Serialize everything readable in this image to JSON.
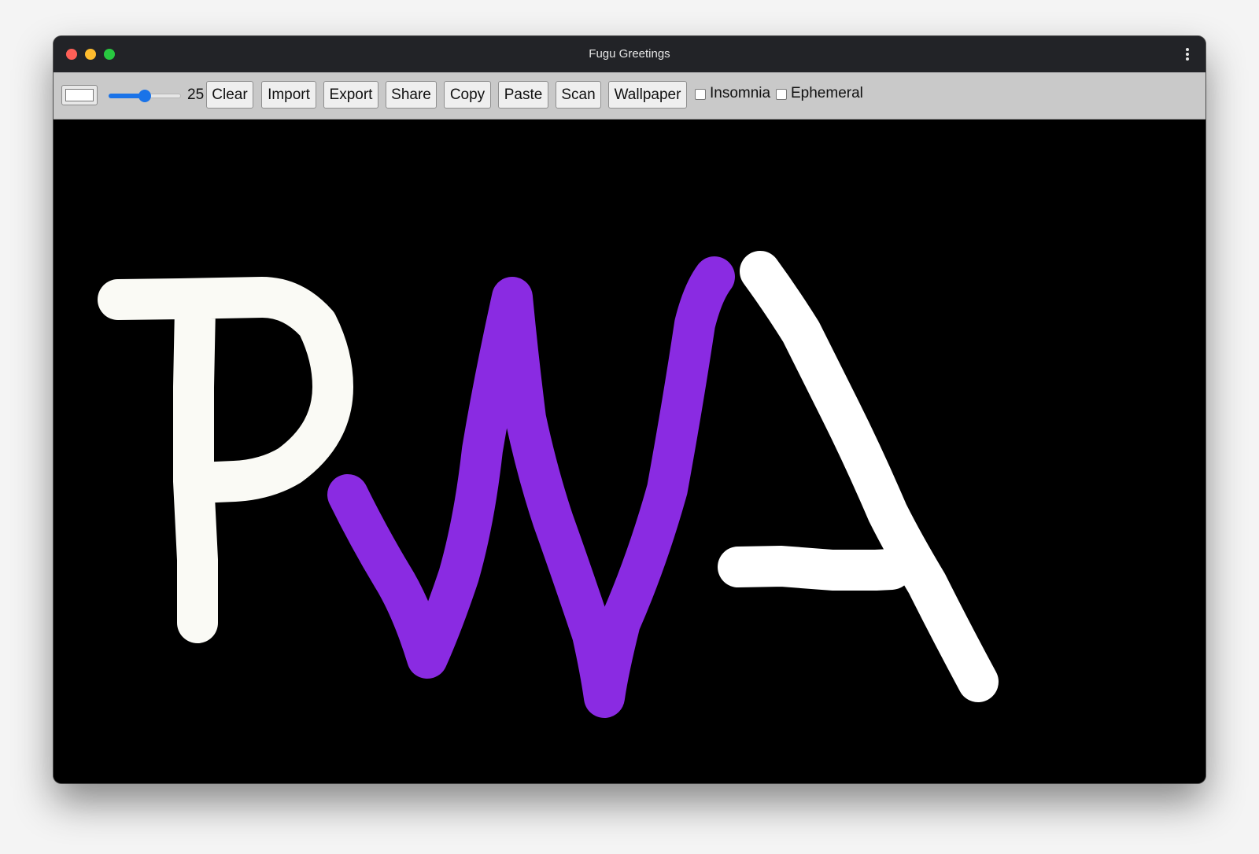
{
  "window": {
    "title": "Fugu Greetings"
  },
  "toolbar": {
    "color_value": "#ffffff",
    "line_width": "25",
    "line_width_fraction": 0.5,
    "buttons": {
      "clear": "Clear",
      "import": "Import",
      "export": "Export",
      "share": "Share",
      "copy": "Copy",
      "paste": "Paste",
      "scan": "Scan",
      "wallpaper": "Wallpaper"
    },
    "checkboxes": {
      "insomnia": {
        "label": "Insomnia",
        "checked": false
      },
      "ephemeral": {
        "label": "Ephemeral",
        "checked": false
      }
    }
  },
  "canvas": {
    "background": "#000000",
    "strokes": [
      {
        "letter": "P",
        "color": "#fafaf5"
      },
      {
        "letter": "W",
        "color": "#8a2be2"
      },
      {
        "letter": "A",
        "color": "#ffffff"
      }
    ]
  },
  "colors": {
    "titlebar": "#222327",
    "toolbar": "#c9c9c9",
    "accent": "#1a73e8"
  }
}
